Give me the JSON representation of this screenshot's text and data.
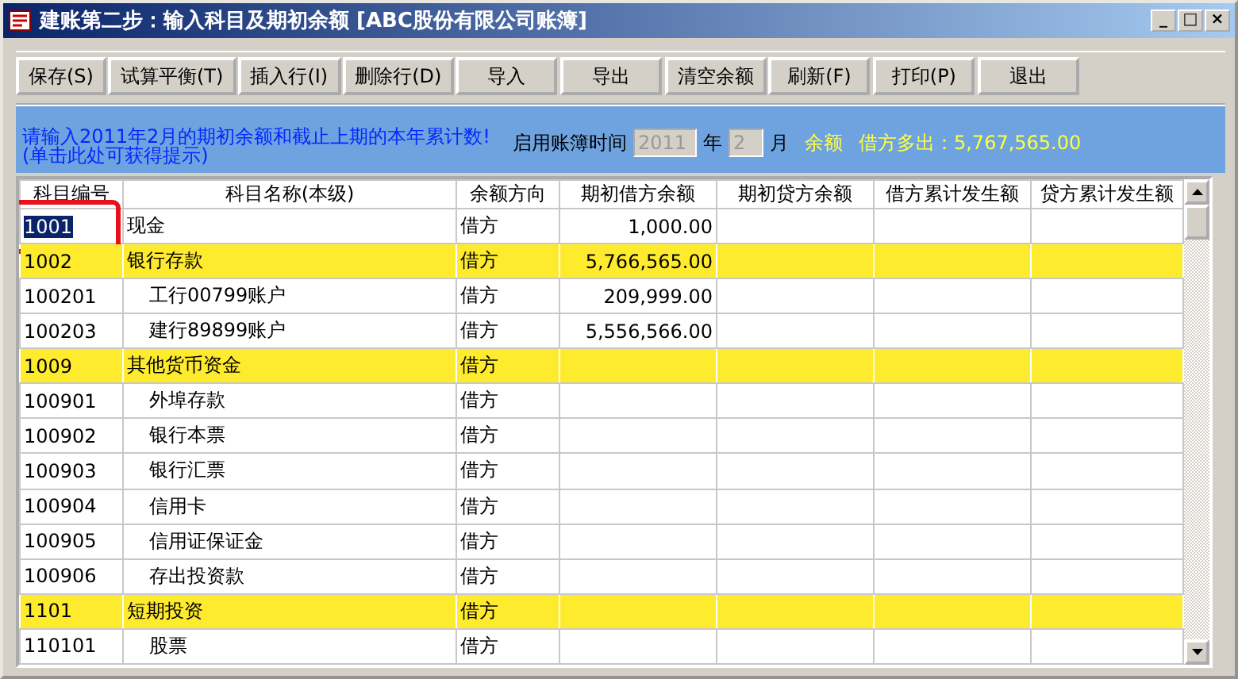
{
  "window": {
    "title": "建账第二步：输入科目及期初余额 [ABC股份有限公司账簿]",
    "controls": [
      "_",
      "□",
      "×"
    ]
  },
  "toolbar": [
    {
      "label": "保存(S)"
    },
    {
      "label": "试算平衡(T)"
    },
    {
      "label": "插入行(I)"
    },
    {
      "label": "删除行(D)"
    },
    {
      "label": "导入"
    },
    {
      "label": "导出"
    },
    {
      "label": "清空余额"
    },
    {
      "label": "刷新(F)"
    },
    {
      "label": "打印(P)"
    },
    {
      "label": "退出"
    }
  ],
  "info": {
    "prompt": "请输入2011年2月的期初余额和截止上期的本年累计数!",
    "hint_link": "(单击此处可获得提示)",
    "start_label": "启用账簿时间",
    "year_value": "2011",
    "year_label": "年",
    "month_value": "2",
    "month_label": "月",
    "fields_disabled": true,
    "balance_label": "余额",
    "balance_text": "借方多出：5,767,565.00"
  },
  "table": {
    "columns": [
      "科目编号",
      "科目名称(本级)",
      "余额方向",
      "期初借方余额",
      "期初贷方余额",
      "借方累计发生额",
      "贷方累计发生额"
    ],
    "rows": [
      {
        "code": "1001",
        "name": "现金",
        "direction": "借方",
        "debit": "1,000.00",
        "highlighted": false,
        "selected": true
      },
      {
        "code": "1002",
        "name": "银行存款",
        "direction": "借方",
        "debit": "5,766,565.00",
        "highlighted": true,
        "selected": false,
        "children": [
          {
            "code": "100201",
            "name": "工行00799账户",
            "direction": "借方",
            "debit": "209,999.00",
            "highlighted": false,
            "selected": false
          },
          {
            "code": "100203",
            "name": "建行89899账户",
            "direction": "借方",
            "debit": "5,556,566.00",
            "highlighted": false,
            "selected": false
          }
        ]
      },
      {
        "code": "1009",
        "name": "其他货币资金",
        "direction": "借方",
        "highlighted": true,
        "selected": false,
        "children": [
          {
            "code": "100901",
            "name": "外埠存款",
            "direction": "借方",
            "highlighted": false,
            "selected": false
          },
          {
            "code": "100902",
            "name": "银行本票",
            "direction": "借方",
            "highlighted": false,
            "selected": false
          },
          {
            "code": "100903",
            "name": "银行汇票",
            "direction": "借方",
            "highlighted": false,
            "selected": false
          },
          {
            "code": "100904",
            "name": "信用卡",
            "direction": "借方",
            "highlighted": false,
            "selected": false
          },
          {
            "code": "100905",
            "name": "信用证保证金",
            "direction": "借方",
            "highlighted": false,
            "selected": false
          },
          {
            "code": "100906",
            "name": "存出投资款",
            "direction": "借方",
            "highlighted": false,
            "selected": false
          }
        ]
      },
      {
        "code": "1101",
        "name": "短期投资",
        "direction": "借方",
        "highlighted": true,
        "selected": false,
        "children": [
          {
            "code": "110101",
            "name": "股票",
            "direction": "借方",
            "highlighted": false,
            "selected": false
          }
        ]
      }
    ]
  }
}
